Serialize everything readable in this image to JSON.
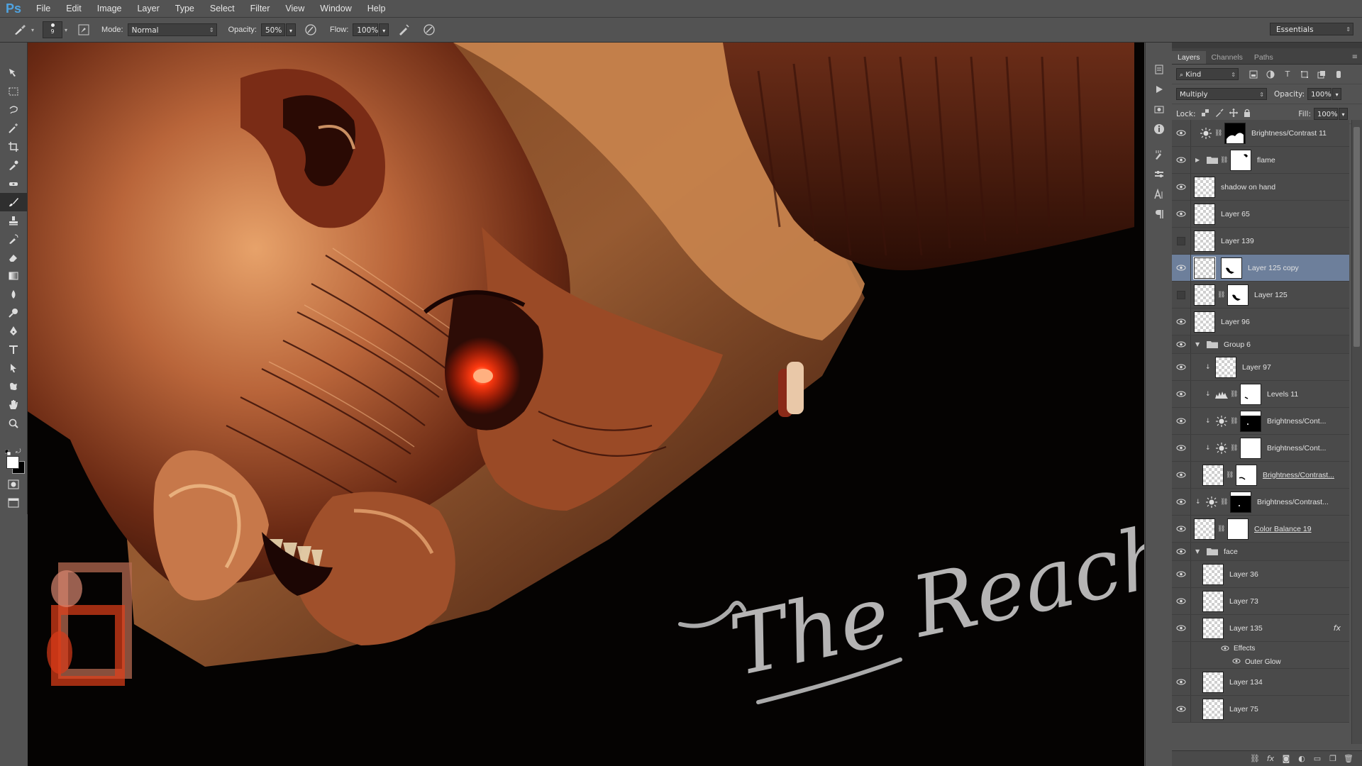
{
  "app": {
    "logo": "Ps",
    "menu": [
      "File",
      "Edit",
      "Image",
      "Layer",
      "Type",
      "Select",
      "Filter",
      "View",
      "Window",
      "Help"
    ],
    "workspace": "Essentials"
  },
  "options": {
    "brush_size": "9",
    "mode_label": "Mode:",
    "mode_value": "Normal",
    "opacity_label": "Opacity:",
    "opacity_value": "50%",
    "flow_label": "Flow:",
    "flow_value": "100%"
  },
  "canvas": {
    "signature": "The Reach"
  },
  "layers_panel": {
    "tabs": [
      "Layers",
      "Channels",
      "Paths"
    ],
    "filter_value": "Kind",
    "blend_mode": "Multiply",
    "opacity_label": "Opacity:",
    "opacity_value": "100%",
    "lock_label": "Lock:",
    "fill_label": "Fill:",
    "fill_value": "100%",
    "layers": [
      {
        "name": "Brightness/Contrast 11"
      },
      {
        "name": "flame"
      },
      {
        "name": "shadow on hand"
      },
      {
        "name": "Layer 65"
      },
      {
        "name": "Layer 139"
      },
      {
        "name": "Layer 125 copy"
      },
      {
        "name": "Layer 125"
      },
      {
        "name": "Layer 96"
      },
      {
        "name": "Group 6"
      },
      {
        "name": "Layer 97"
      },
      {
        "name": "Levels 11"
      },
      {
        "name": "Brightness/Cont..."
      },
      {
        "name": "Brightness/Cont..."
      },
      {
        "name": "Brightness/Contrast..."
      },
      {
        "name": "Brightness/Contrast..."
      },
      {
        "name": "Color Balance 19"
      },
      {
        "name": "face"
      },
      {
        "name": "Layer 36"
      },
      {
        "name": "Layer 73"
      },
      {
        "name": "Layer 135"
      },
      {
        "name": "Effects"
      },
      {
        "name": "Outer Glow"
      },
      {
        "name": "Layer 134"
      },
      {
        "name": "Layer 75"
      }
    ],
    "fx_label": "fx"
  },
  "colors": {
    "ui_bg": "#535353",
    "selected_layer": "#6d7f9b",
    "accent": "#4fa3e0"
  }
}
